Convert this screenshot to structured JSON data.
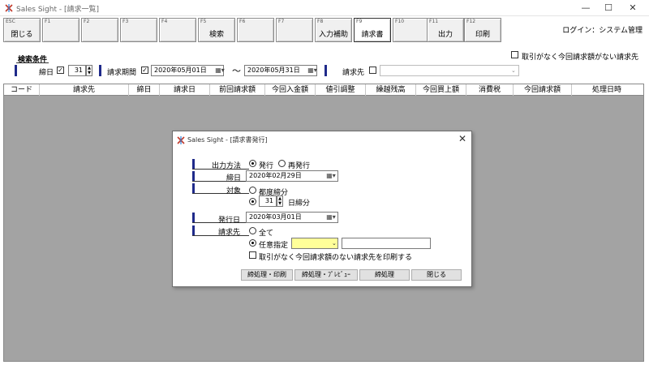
{
  "window": {
    "title": "Sales Sight - [請求一覧]"
  },
  "fkeys": [
    {
      "num": "ESC",
      "label": "閉じる"
    },
    {
      "num": "F1",
      "label": ""
    },
    {
      "num": "F2",
      "label": ""
    },
    {
      "num": "F3",
      "label": ""
    },
    {
      "num": "F4",
      "label": ""
    },
    {
      "num": "F5",
      "label": "検索"
    },
    {
      "num": "F6",
      "label": ""
    },
    {
      "num": "F7",
      "label": ""
    },
    {
      "num": "F8",
      "label": "入力補助"
    },
    {
      "num": "F9",
      "label": "請求書"
    },
    {
      "num": "F10",
      "label": ""
    },
    {
      "num": "F11",
      "label": "出力"
    },
    {
      "num": "F12",
      "label": "印刷"
    }
  ],
  "login": "ログイン：システム管理",
  "search": {
    "title": "検索条件",
    "closing_label": "締日",
    "closing_day": "31",
    "period_label": "請求期間",
    "period_from": "2020年05月01日",
    "period_to": "2020年05月31日",
    "tilde": "～",
    "customer_label": "請求先",
    "no_transactions_label": "取引がなく今回請求額がない請求先"
  },
  "grid": {
    "columns": [
      "コード",
      "請求先",
      "締日",
      "請求日",
      "前回請求額",
      "今回入金額",
      "値引調整",
      "繰越残高",
      "今回買上額",
      "消費税",
      "今回請求額",
      "処理日時"
    ]
  },
  "dialog": {
    "title": "Sales Sight - [請求書発行]",
    "output_method_label": "出力方法",
    "output_issue": "発行",
    "output_reissue": "再発行",
    "closing_date_label": "締日",
    "closing_date": "2020年02月29日",
    "target_label": "対象",
    "target_each": "都度締分",
    "target_day": "31",
    "target_day_suffix": "日締分",
    "issue_date_label": "発行日",
    "issue_date": "2020年03月01日",
    "customer_label": "請求先",
    "customer_all": "全て",
    "customer_specify": "任意指定",
    "print_no_transactions": "取引がなく今回請求額のない請求先を印刷する",
    "buttons": [
      "締処理・印刷",
      "締処理・ﾌﾟﾚﾋﾞｭｰ",
      "締処理",
      "閉じる"
    ]
  },
  "colors": {
    "accent_mark": "#1f2a8a",
    "grid_bg": "#a3a3a3",
    "highlight_field": "#ffff99"
  }
}
